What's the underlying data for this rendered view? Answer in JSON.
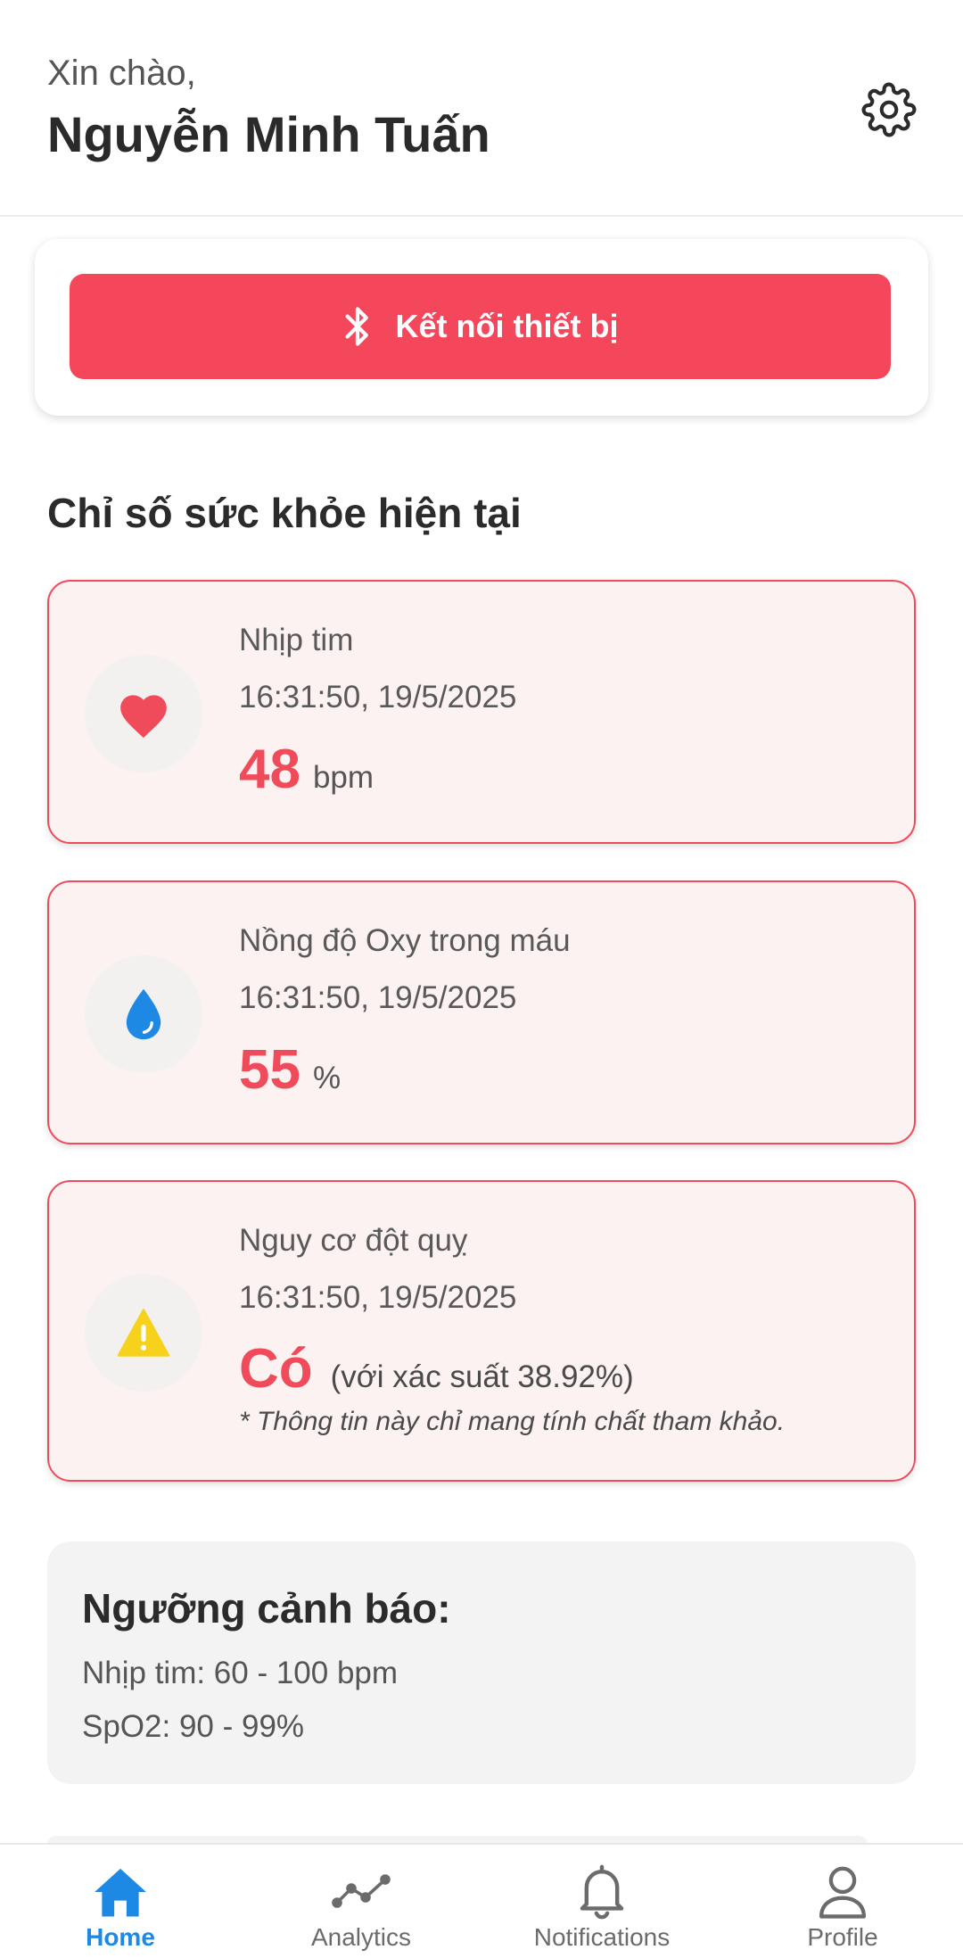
{
  "header": {
    "greeting": "Xin chào,",
    "username": "Nguyễn Minh Tuấn",
    "settings_icon": "gear-icon"
  },
  "connect": {
    "label": "Kết nối thiết bị",
    "icon": "bluetooth-icon",
    "color": "#f4475c"
  },
  "section_title": "Chỉ số sức khỏe hiện tại",
  "metrics": [
    {
      "icon": "heart-icon",
      "label": "Nhịp tim",
      "time": "16:31:50, 19/5/2025",
      "value": "48",
      "unit": "bpm"
    },
    {
      "icon": "water-drop-icon",
      "label": "Nồng độ Oxy trong máu",
      "time": "16:31:50, 19/5/2025",
      "value": "55",
      "unit": "%"
    }
  ],
  "stroke": {
    "icon": "warning-icon",
    "label": "Nguy cơ đột quỵ",
    "time": "16:31:50, 19/5/2025",
    "value": "Có",
    "probability": "(với xác suất 38.92%)",
    "disclaimer": "* Thông tin này chỉ mang tính chất tham khảo."
  },
  "thresholds": {
    "title": "Ngưỡng cảnh báo:",
    "heart_rate": "Nhịp tim: 60 - 100 bpm",
    "spo2": "SpO2: 90 - 99%"
  },
  "nav": [
    {
      "label": "Home",
      "icon": "home-icon",
      "active": true
    },
    {
      "label": "Analytics",
      "icon": "analytics-icon",
      "active": false
    },
    {
      "label": "Notifications",
      "icon": "bell-icon",
      "active": false
    },
    {
      "label": "Profile",
      "icon": "person-icon",
      "active": false
    }
  ],
  "colors": {
    "accent_red": "#f04b5a",
    "active_blue": "#1e88e5",
    "card_bg": "#fdf2f2"
  }
}
